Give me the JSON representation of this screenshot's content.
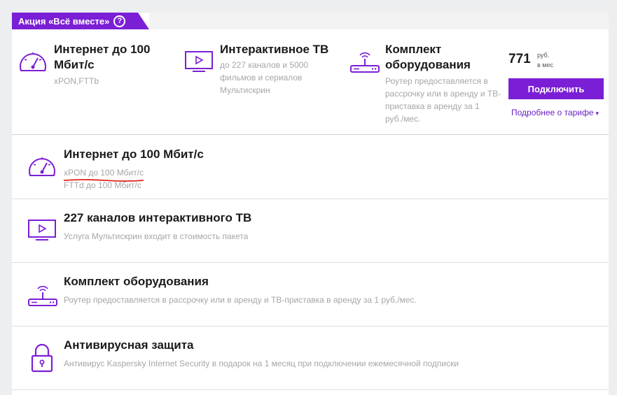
{
  "promo": {
    "label": "Акция «Всё вместе»",
    "help_icon": "?"
  },
  "summary": {
    "features": [
      {
        "icon": "speedometer-icon",
        "title_lines": [
          "Интернет до 100",
          "Мбит/с"
        ],
        "desc_lines": [
          "xPON,FTTb"
        ]
      },
      {
        "icon": "tv-icon",
        "title_lines": [
          "Интерактивное ТВ"
        ],
        "desc_lines": [
          "до 227 каналов и 5000",
          "фильмов и сериалов",
          "Мультискрин"
        ]
      },
      {
        "icon": "router-icon",
        "title_lines": [
          "Комплект",
          "оборудования"
        ],
        "desc_lines": [
          "Роутер предоставляется в",
          "рассрочку или в аренду и ТВ-",
          "приставка в аренду за 1",
          "руб./мес."
        ]
      }
    ],
    "price": {
      "value": "771",
      "currency": "руб.",
      "period": "в мес"
    },
    "connect_button": "Подключить",
    "more_link": "Подробнее о тарифе",
    "more_caret": "▾"
  },
  "details": [
    {
      "icon": "speedometer-icon",
      "title": "Интернет до 100 Мбит/с",
      "desc_lines": [
        "xPON до 100 Мбит/с",
        "FTTd до 100 Мбит/с"
      ]
    },
    {
      "icon": "tv-icon",
      "title": "227 каналов интерактивного ТВ",
      "desc_lines": [
        "Услуга Мультискрин входит в стоимость пакета"
      ]
    },
    {
      "icon": "router-icon",
      "title": "Комплект оборудования",
      "desc_lines": [
        "Роутер предоставляется в рассрочку или в аренду и ТВ-приставка в аренду за 1 руб./мес."
      ]
    },
    {
      "icon": "lock-icon",
      "title": "Антивирусная защита",
      "desc_lines": [
        "Антивирус Kaspersky Internet Security в подарок на 1 месяц при подключении ежемесячной подписки"
      ]
    }
  ],
  "colors": {
    "accent": "#7b1fd6",
    "annotation": "#e0241f"
  }
}
